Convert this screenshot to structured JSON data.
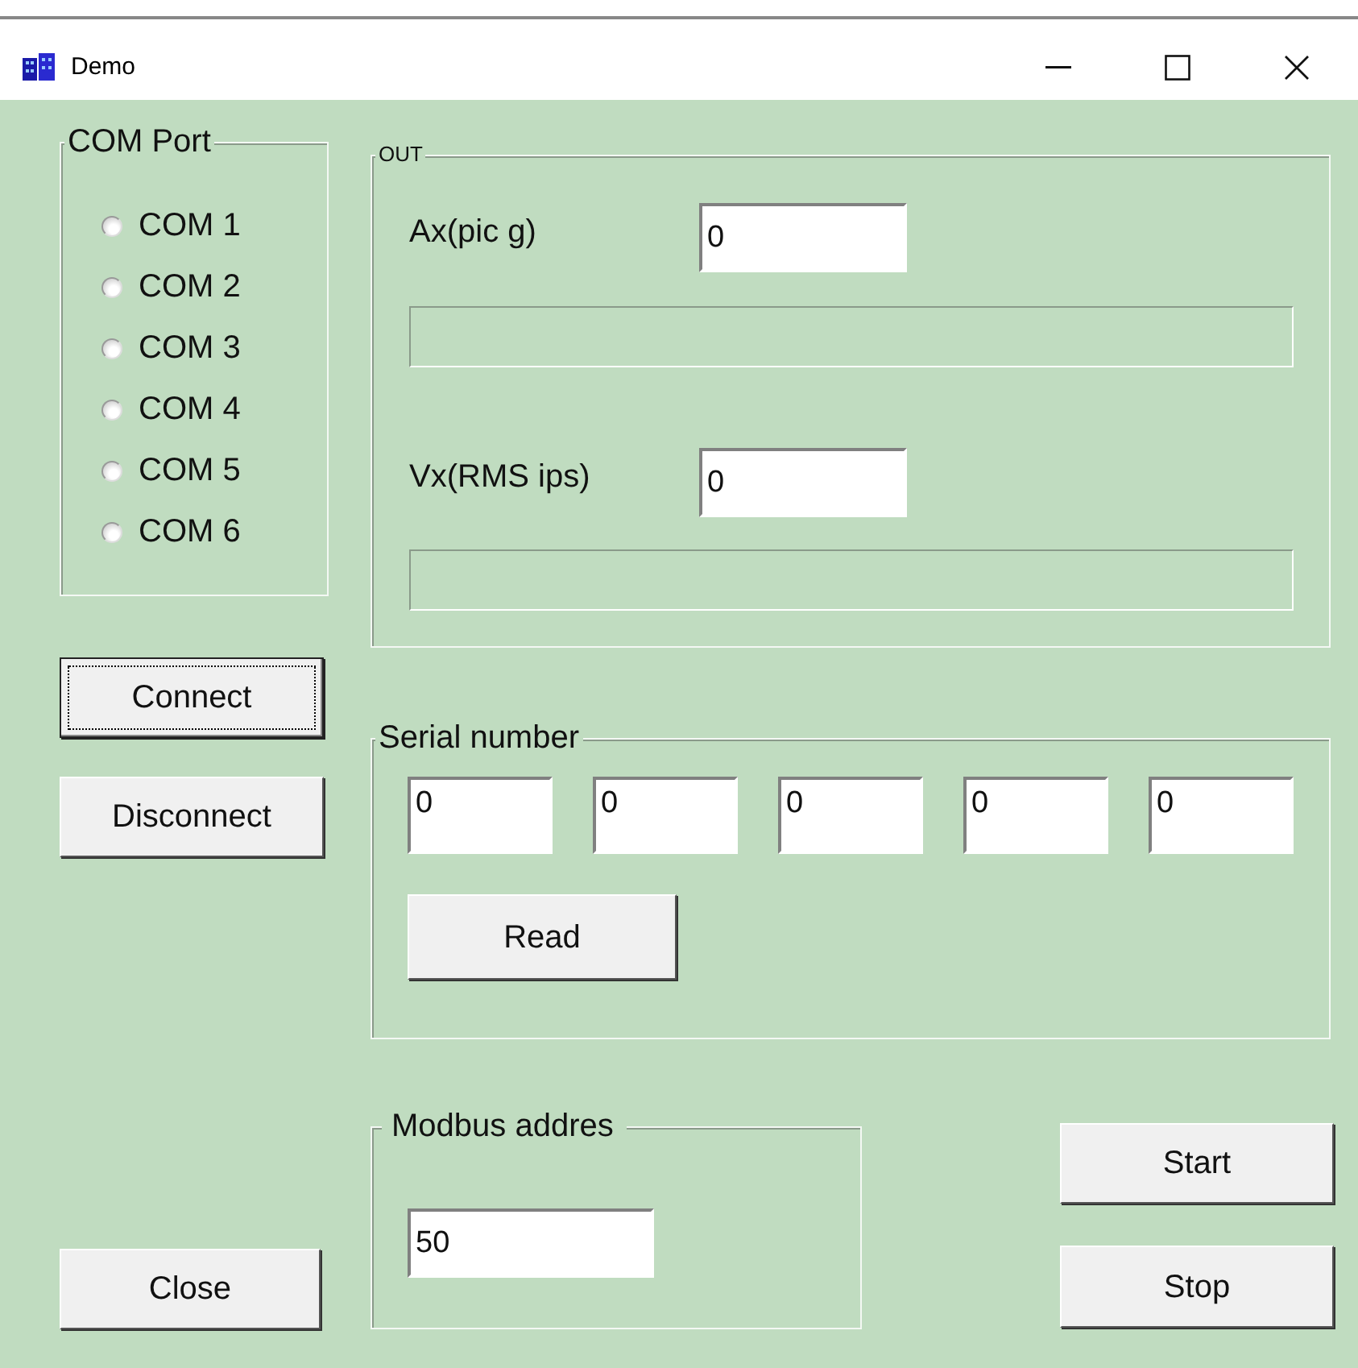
{
  "window": {
    "title": "Demo"
  },
  "com_port": {
    "label": "COM Port",
    "options": [
      {
        "label": "COM 1",
        "selected": false
      },
      {
        "label": "COM 2",
        "selected": false
      },
      {
        "label": "COM 3",
        "selected": false
      },
      {
        "label": "COM 4",
        "selected": false
      },
      {
        "label": "COM 5",
        "selected": false
      },
      {
        "label": "COM 6",
        "selected": false
      }
    ]
  },
  "out": {
    "label": "OUT",
    "rows": [
      {
        "label": "Ax(pic g)",
        "value": "0",
        "level": 0
      },
      {
        "label": "Vx(RMS ips)",
        "value": "0",
        "level": 0
      }
    ]
  },
  "connection_buttons": [
    {
      "label": "Connect",
      "focused": true
    },
    {
      "label": "Disconnect",
      "focused": false
    }
  ],
  "serial_number": {
    "label": "Serial number",
    "values": [
      "0",
      "0",
      "0",
      "0",
      "0"
    ],
    "button": "Read"
  },
  "modbus": {
    "label": "Modbus addres",
    "value": "50"
  },
  "close_button": "Close",
  "start_button": "Start",
  "stop_button": "Stop"
}
